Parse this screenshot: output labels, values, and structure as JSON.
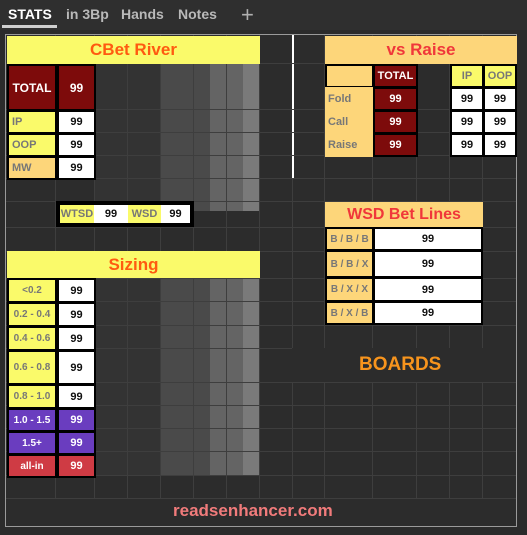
{
  "tabs": [
    {
      "label": "STATS",
      "active": true
    },
    {
      "label": "in 3Bp",
      "active": false
    },
    {
      "label": "Hands",
      "active": false
    },
    {
      "label": "Notes",
      "active": false
    }
  ],
  "add_tab_icon": "plus-icon",
  "cbet_river": {
    "title": "CBet River",
    "total_label": "TOTAL",
    "total_value": "99",
    "rows": [
      {
        "label": "IP",
        "value": "99"
      },
      {
        "label": "OOP",
        "value": "99"
      },
      {
        "label": "MW",
        "value": "99"
      }
    ]
  },
  "showdown": {
    "wtsd_label": "WTSD",
    "wtsd_value": "99",
    "wsd_label": "WSD",
    "wsd_value": "99"
  },
  "sizing": {
    "title": "Sizing",
    "rows": [
      {
        "label": "<0.2",
        "value": "99"
      },
      {
        "label": "0.2 - 0.4",
        "value": "99"
      },
      {
        "label": "0.4 - 0.6",
        "value": "99"
      },
      {
        "label": "0.6 - 0.8",
        "value": "99"
      },
      {
        "label": "0.8 - 1.0",
        "value": "99"
      },
      {
        "label": "1.0 - 1.5",
        "value": "99"
      },
      {
        "label": "1.5+",
        "value": "99"
      },
      {
        "label": "all-in",
        "value": "99"
      }
    ]
  },
  "vs_raise": {
    "title": "vs Raise",
    "total_header": "TOTAL",
    "ip_header": "IP",
    "oop_header": "OOP",
    "rows": [
      {
        "label": "Fold",
        "total": "99",
        "ip": "99",
        "oop": "99"
      },
      {
        "label": "Call",
        "total": "99",
        "ip": "99",
        "oop": "99"
      },
      {
        "label": "Raise",
        "total": "99",
        "ip": "99",
        "oop": "99"
      }
    ]
  },
  "wsd_bet_lines": {
    "title": "WSD Bet Lines",
    "rows": [
      {
        "label": "B / B / B",
        "value": "99"
      },
      {
        "label": "B / B / X",
        "value": "99"
      },
      {
        "label": "B / X / X",
        "value": "99"
      },
      {
        "label": "B / X / B",
        "value": "99"
      }
    ]
  },
  "boards_label": "BOARDS",
  "footer": "readsenhancer.com",
  "colors": {
    "header_yellow": "#fafa6a",
    "header_peach": "#fdd67a",
    "title_orange": "#ff5a10",
    "title_red": "#f0373a",
    "maroon": "#7d0b0b",
    "purple": "#6a3dbf",
    "red": "#cf3b44",
    "boards_orange": "#f7941d",
    "footer_pink": "#f17b7b"
  }
}
